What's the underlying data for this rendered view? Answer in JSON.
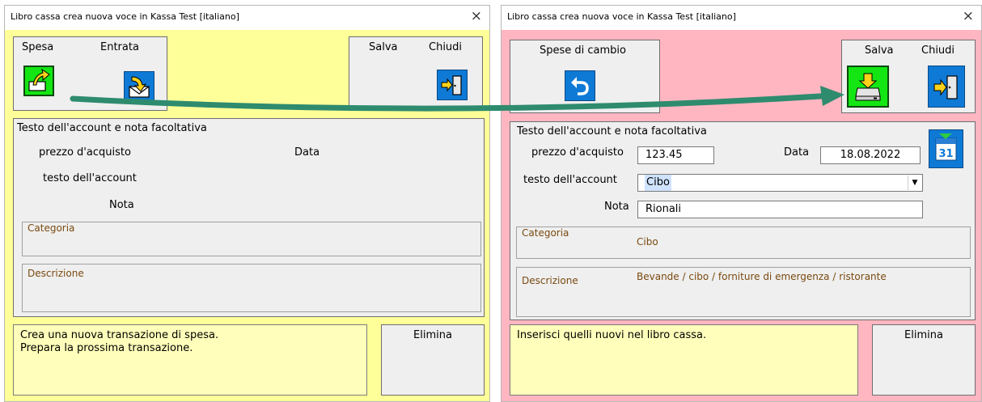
{
  "left": {
    "title": "Libro cassa crea nuova voce in Kassa Test  [italiano]",
    "close": "×",
    "spesa": "Spesa",
    "entrata": "Entrata",
    "salva": "Salva",
    "chiudi": "Chiudi",
    "section_title": "Testo dell'account e nota facoltativa",
    "price_label": "prezzo d'acquisto",
    "date_label": "Data",
    "account_label": "testo dell'account",
    "note_label": "Nota",
    "category_label": "Categoria",
    "description_label": "Descrizione",
    "message_line1": "Crea una nuova transazione di spesa.",
    "message_line2": "Prepara la prossima transazione.",
    "elimina": "Elimina"
  },
  "right": {
    "title": "Libro cassa crea nuova voce in Kassa Test  [italiano]",
    "close": "×",
    "spese_cambio": "Spese di cambio",
    "salva": "Salva",
    "chiudi": "Chiudi",
    "section_title": "Testo dell'account e nota facoltativa",
    "price_label": "prezzo d'acquisto",
    "price_value": "123.45",
    "date_label": "Data",
    "date_value": "18.08.2022",
    "calendar_day": "31",
    "account_label": "testo dell'account",
    "account_value": "Cibo",
    "note_label": "Nota",
    "note_value": "Rionali",
    "category_label": "Categoria",
    "category_value": "Cibo",
    "description_label": "Descrizione",
    "description_value": "Bevande / cibo / forniture di emergenza / ristorante",
    "message": "Inserisci quelli nuovi nel libro cassa.",
    "elimina": "Elimina"
  },
  "colors": {
    "left_bg": "#ffff99",
    "right_bg": "#ffb6c1",
    "arrow": "#2e8b6e",
    "green_button": "#14e614",
    "blue_button": "#0e7ad6"
  },
  "icons": [
    "expense-icon",
    "income-icon",
    "exit-door-icon",
    "undo-arrow-icon",
    "save-tray-icon",
    "calendar-icon"
  ]
}
